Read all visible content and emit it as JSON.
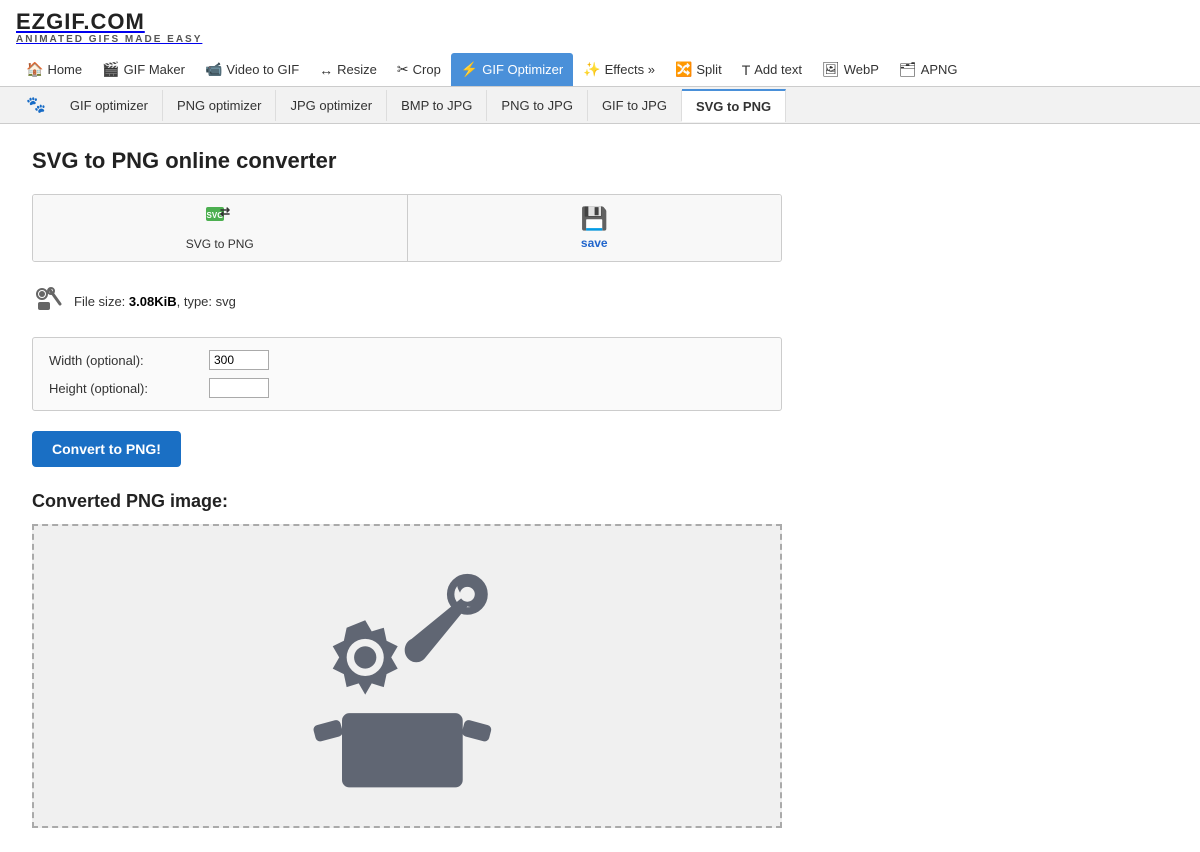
{
  "logo": {
    "text": "EZGIF.COM",
    "sub": "ANIMATED GIFS MADE EASY"
  },
  "nav": {
    "items": [
      {
        "id": "home",
        "label": "Home",
        "icon": "🏠",
        "active": false
      },
      {
        "id": "gif-maker",
        "label": "GIF Maker",
        "icon": "🎬",
        "active": false
      },
      {
        "id": "video-to-gif",
        "label": "Video to GIF",
        "icon": "📹",
        "active": false
      },
      {
        "id": "resize",
        "label": "Resize",
        "icon": "↔",
        "active": false
      },
      {
        "id": "crop",
        "label": "Crop",
        "icon": "✂",
        "active": false
      },
      {
        "id": "gif-optimizer",
        "label": "GIF Optimizer",
        "icon": "⚡",
        "active": true
      },
      {
        "id": "effects",
        "label": "Effects »",
        "icon": "✨",
        "active": false
      },
      {
        "id": "split",
        "label": "Split",
        "icon": "🔀",
        "active": false
      },
      {
        "id": "add-text",
        "label": "Add text",
        "icon": "T",
        "active": false
      },
      {
        "id": "webp",
        "label": "WebP",
        "icon": "🖼",
        "active": false
      },
      {
        "id": "apng",
        "label": "APNG",
        "icon": "🗂",
        "active": false
      }
    ]
  },
  "subnav": {
    "items": [
      {
        "id": "gif-optimizer",
        "label": "GIF optimizer",
        "active": false
      },
      {
        "id": "png-optimizer",
        "label": "PNG optimizer",
        "active": false
      },
      {
        "id": "jpg-optimizer",
        "label": "JPG optimizer",
        "active": false
      },
      {
        "id": "bmp-to-jpg",
        "label": "BMP to JPG",
        "active": false
      },
      {
        "id": "png-to-jpg",
        "label": "PNG to JPG",
        "active": false
      },
      {
        "id": "gif-to-jpg",
        "label": "GIF to JPG",
        "active": false
      },
      {
        "id": "svg-to-png",
        "label": "SVG to PNG",
        "active": true
      }
    ]
  },
  "page": {
    "title": "SVG to PNG online converter"
  },
  "action_buttons": {
    "svg_to_png": {
      "label": "SVG to PNG",
      "icon": "↔"
    },
    "save": {
      "label": "save",
      "icon": "💾"
    }
  },
  "file": {
    "size": "3.08KiB",
    "type": "svg",
    "size_label": "File size: ",
    "type_label": ", type: "
  },
  "options": {
    "width_label": "Width (optional):",
    "width_value": "300",
    "height_label": "Height (optional):",
    "height_value": ""
  },
  "convert_button": {
    "label": "Convert to PNG!"
  },
  "converted": {
    "title": "Converted PNG image:"
  },
  "colors": {
    "active_nav_bg": "#4a90d9",
    "active_subnav_border": "#4a90d9",
    "convert_btn": "#1a6fc4"
  }
}
